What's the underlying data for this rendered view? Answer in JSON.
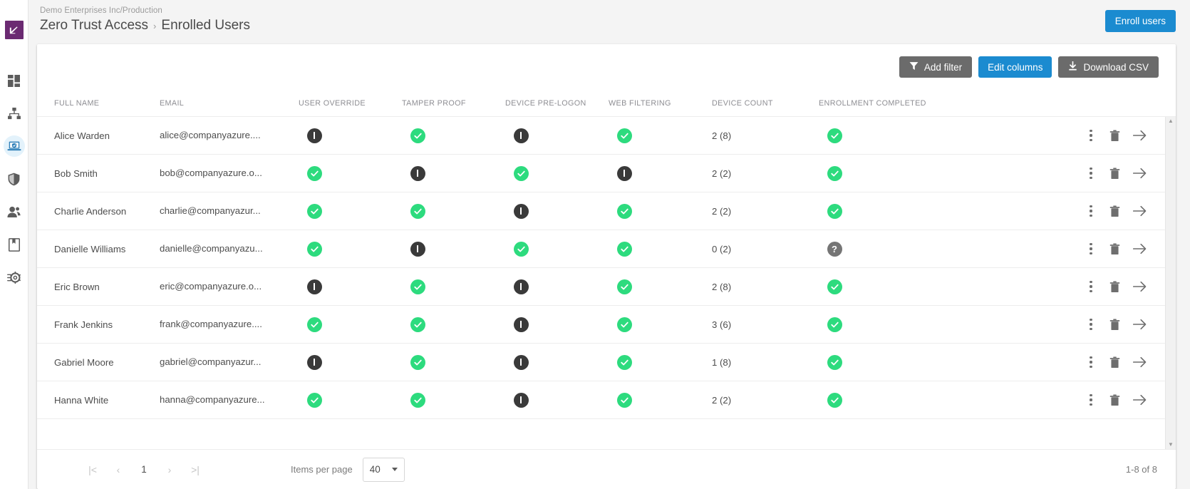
{
  "sidebar": {
    "items": [
      {
        "name": "logo",
        "icon": "chart-logo-icon",
        "active": false
      },
      {
        "name": "dashboard",
        "icon": "dashboard-grid-icon",
        "active": false
      },
      {
        "name": "network",
        "icon": "network-topology-icon",
        "active": false
      },
      {
        "name": "zero-trust-access",
        "icon": "laptop-shield-icon",
        "active": true
      },
      {
        "name": "security",
        "icon": "shield-icon",
        "active": false
      },
      {
        "name": "users",
        "icon": "users-icon",
        "active": false
      },
      {
        "name": "reports",
        "icon": "book-bookmark-icon",
        "active": false
      },
      {
        "name": "settings",
        "icon": "gear-arrow-icon",
        "active": false
      }
    ]
  },
  "header": {
    "org": "Demo Enterprises Inc/Production",
    "section": "Zero Trust Access",
    "separator": "›",
    "page_title": "Enrolled Users",
    "enroll_users_label": "Enroll users",
    "accent_color": "#1b8bd0",
    "logo_color": "#6b2a72"
  },
  "toolbar": {
    "add_filter_label": "Add filter",
    "add_filter_icon": "funnel-icon",
    "edit_columns_label": "Edit columns",
    "download_csv_label": "Download CSV",
    "download_csv_icon": "download-icon",
    "grey_color": "#6b6b6b",
    "blue_color": "#1b8bd0"
  },
  "table": {
    "columns": [
      "FULL NAME",
      "EMAIL",
      "USER OVERRIDE",
      "TAMPER PROOF",
      "DEVICE PRE-LOGON",
      "WEB FILTERING",
      "DEVICE COUNT",
      "ENROLLMENT COMPLETED"
    ],
    "status_colors": {
      "on": "#2ddb7e",
      "off": "#3a3a3a",
      "unknown": "#757575"
    },
    "row_actions": [
      "more-vertical-icon",
      "trash-icon",
      "arrow-right-icon"
    ],
    "rows": [
      {
        "full_name": "Alice Warden",
        "email": "alice@companyazure....",
        "user_override": "off",
        "tamper_proof": "on",
        "device_pre_logon": "off",
        "web_filtering": "on",
        "device_count": "2 (8)",
        "enrollment_completed": "on"
      },
      {
        "full_name": "Bob Smith",
        "email": "bob@companyazure.o...",
        "user_override": "on",
        "tamper_proof": "off",
        "device_pre_logon": "on",
        "web_filtering": "off",
        "device_count": "2 (2)",
        "enrollment_completed": "on"
      },
      {
        "full_name": "Charlie Anderson",
        "email": "charlie@companyazur...",
        "user_override": "on",
        "tamper_proof": "on",
        "device_pre_logon": "off",
        "web_filtering": "on",
        "device_count": "2 (2)",
        "enrollment_completed": "on"
      },
      {
        "full_name": "Danielle Williams",
        "email": "danielle@companyazu...",
        "user_override": "on",
        "tamper_proof": "off",
        "device_pre_logon": "on",
        "web_filtering": "on",
        "device_count": "0 (2)",
        "enrollment_completed": "unknown"
      },
      {
        "full_name": "Eric Brown",
        "email": "eric@companyazure.o...",
        "user_override": "off",
        "tamper_proof": "on",
        "device_pre_logon": "off",
        "web_filtering": "on",
        "device_count": "2 (8)",
        "enrollment_completed": "on"
      },
      {
        "full_name": "Frank Jenkins",
        "email": "frank@companyazure....",
        "user_override": "on",
        "tamper_proof": "on",
        "device_pre_logon": "off",
        "web_filtering": "on",
        "device_count": "3 (6)",
        "enrollment_completed": "on"
      },
      {
        "full_name": "Gabriel Moore",
        "email": "gabriel@companyazur...",
        "user_override": "off",
        "tamper_proof": "on",
        "device_pre_logon": "off",
        "web_filtering": "on",
        "device_count": "1 (8)",
        "enrollment_completed": "on"
      },
      {
        "full_name": "Hanna White",
        "email": "hanna@companyazure...",
        "user_override": "on",
        "tamper_proof": "on",
        "device_pre_logon": "off",
        "web_filtering": "on",
        "device_count": "2 (2)",
        "enrollment_completed": "on"
      }
    ]
  },
  "paginator": {
    "first_label": "|<",
    "prev_label": "‹",
    "current_page": "1",
    "next_label": "›",
    "last_label": ">|",
    "items_per_page_label": "Items per page",
    "items_per_page_value": "40",
    "range_label": "1-8 of 8"
  }
}
